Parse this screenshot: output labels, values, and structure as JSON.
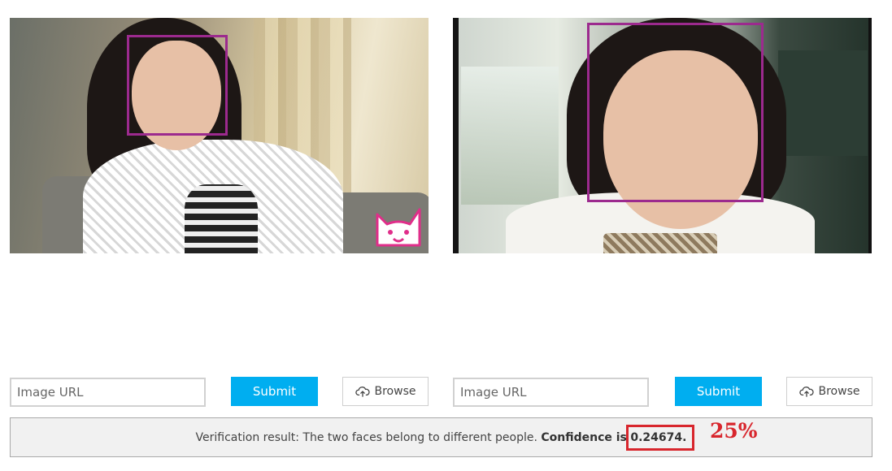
{
  "panels": {
    "left": {
      "url_placeholder": "Image URL",
      "submit_label": "Submit",
      "browse_label": "Browse"
    },
    "right": {
      "url_placeholder": "Image URL",
      "submit_label": "Submit",
      "browse_label": "Browse"
    }
  },
  "result": {
    "prefix": "Verification result: The two faces belong to different people.",
    "confidence_label": "Confidence is",
    "confidence_value": "0.24674."
  },
  "annotation": {
    "percent_text": "25%",
    "color": "#d8262d"
  },
  "colors": {
    "submit": "#00aef0",
    "face_box": "#9c2a8e"
  }
}
